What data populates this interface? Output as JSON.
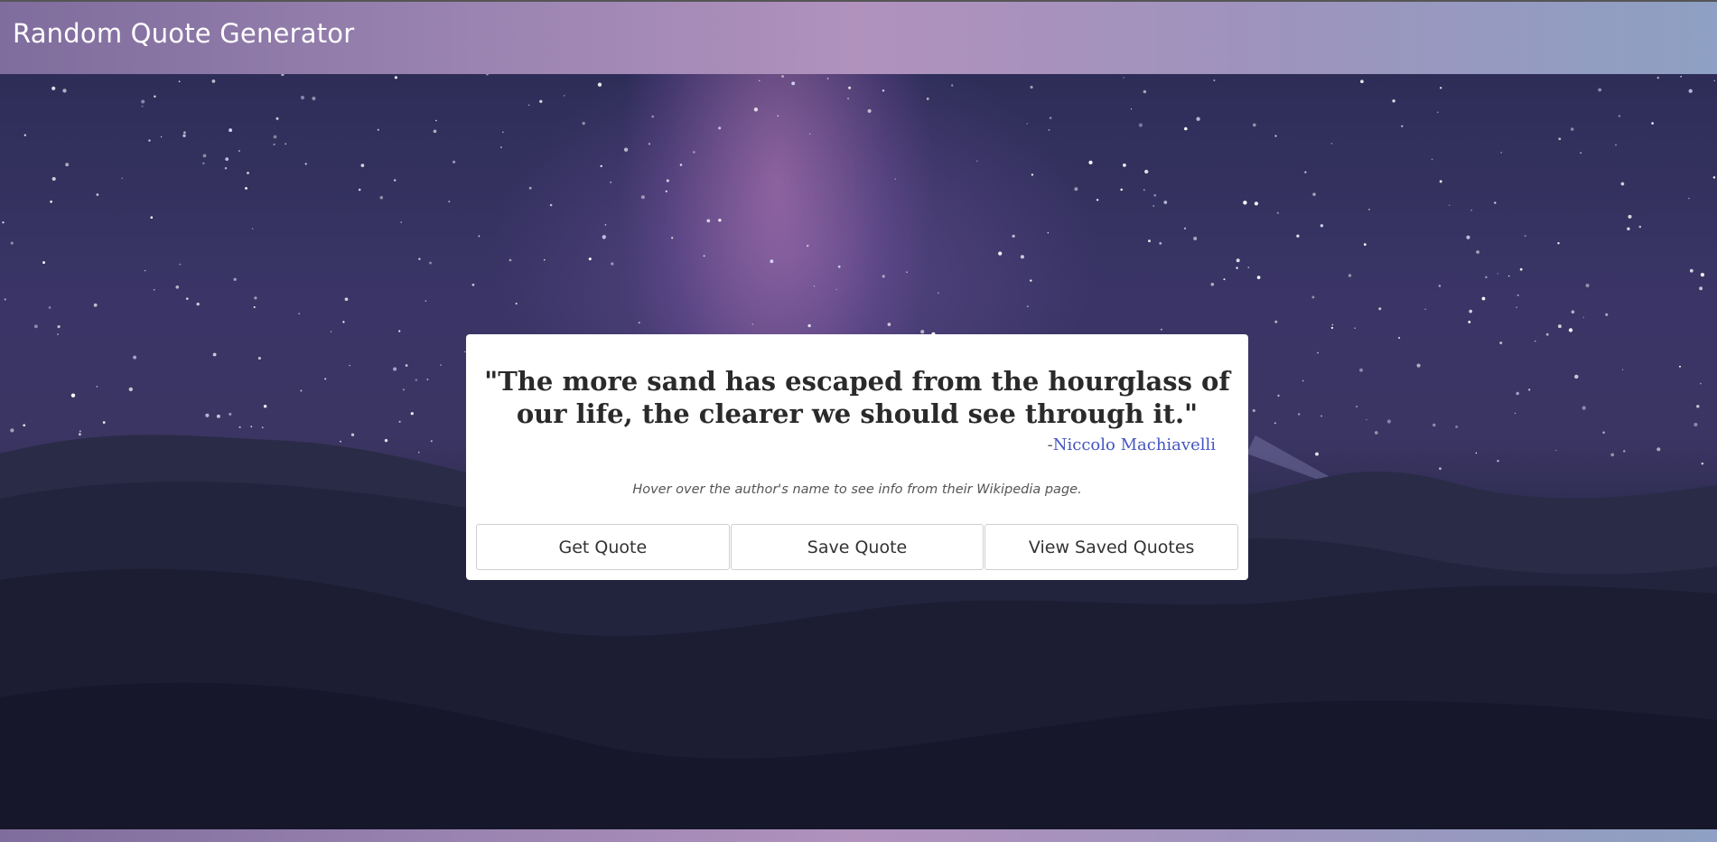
{
  "header": {
    "title": "Random Quote Generator"
  },
  "quote": {
    "text": "\"The more sand has escaped from the hourglass of our life, the clearer we should see through it.\"",
    "author_prefix": "-",
    "author": "Niccolo Machiavelli",
    "hint": "Hover over the author's name to see info from their Wikipedia page."
  },
  "buttons": {
    "get_quote": "Get Quote",
    "save_quote": "Save Quote",
    "view_saved": "View Saved Quotes"
  },
  "colors": {
    "header_gradient_start": "#7f6d9d",
    "header_gradient_mid": "#b092bd",
    "header_gradient_end": "#8ea0c3",
    "author_link": "#4456c0",
    "card_background": "#ffffff"
  },
  "background": {
    "scene": "starry night sky with milky way over desert sand dunes with a person holding a headlamp"
  }
}
